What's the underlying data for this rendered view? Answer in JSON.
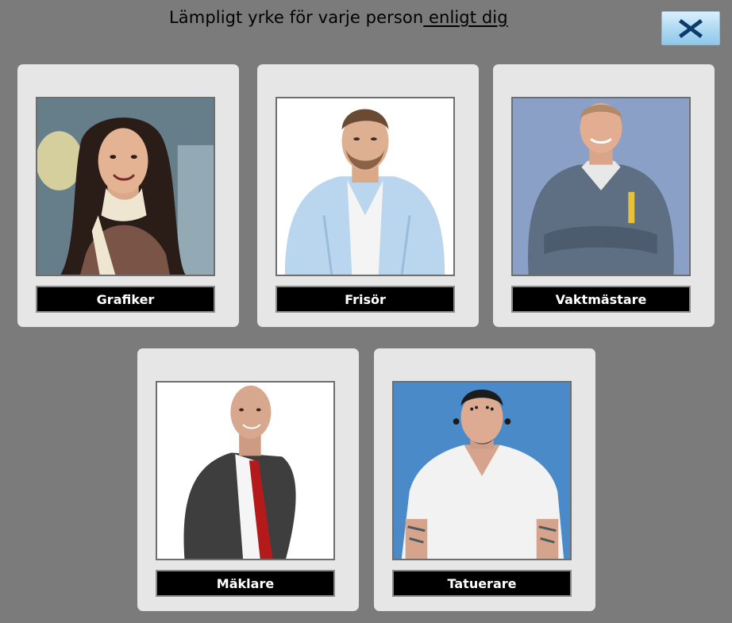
{
  "header": {
    "title_main": "Lämpligt yrke för varje person",
    "title_emphasis": " enligt dig",
    "close_icon": "close-x-icon",
    "close_color": "#0d3a6b"
  },
  "cards": [
    {
      "label": "Grafiker",
      "photo": "smiling-woman-long-dark-hair-photo"
    },
    {
      "label": "Frisör",
      "photo": "bearded-man-light-blue-shirt-photo"
    },
    {
      "label": "Vaktmästare",
      "photo": "smiling-man-grey-work-uniform-photo"
    },
    {
      "label": "Mäklare",
      "photo": "bald-man-suit-red-tie-photo"
    },
    {
      "label": "Tatuerare",
      "photo": "tattooed-man-white-tshirt-photo"
    }
  ]
}
